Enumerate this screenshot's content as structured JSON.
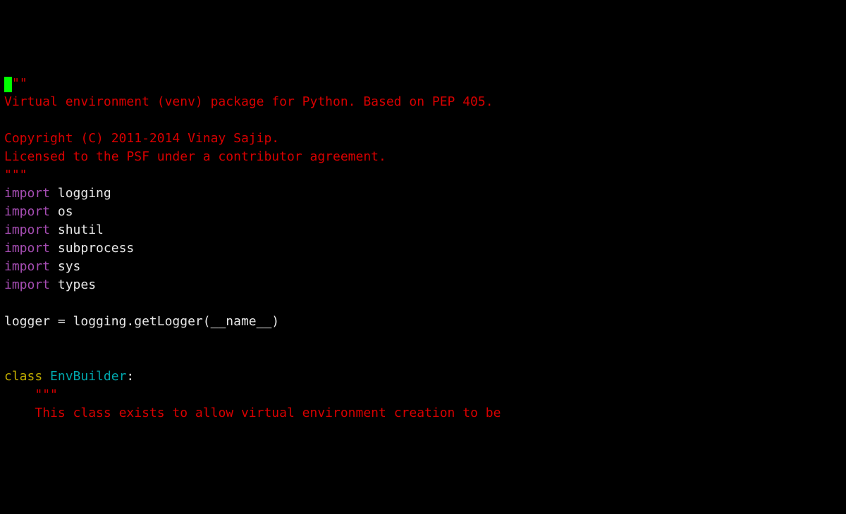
{
  "lines": [
    {
      "type": "docstring_open",
      "text": "\"\"\"",
      "has_cursor": true
    },
    {
      "type": "docstring",
      "text": "Virtual environment (venv) package for Python. Based on PEP 405."
    },
    {
      "type": "blank",
      "text": ""
    },
    {
      "type": "docstring",
      "text": "Copyright (C) 2011-2014 Vinay Sajip."
    },
    {
      "type": "docstring",
      "text": "Licensed to the PSF under a contributor agreement."
    },
    {
      "type": "docstring",
      "text": "\"\"\""
    },
    {
      "type": "import",
      "keyword": "import",
      "module": "logging"
    },
    {
      "type": "import",
      "keyword": "import",
      "module": "os"
    },
    {
      "type": "import",
      "keyword": "import",
      "module": "shutil"
    },
    {
      "type": "import",
      "keyword": "import",
      "module": "subprocess"
    },
    {
      "type": "import",
      "keyword": "import",
      "module": "sys"
    },
    {
      "type": "import",
      "keyword": "import",
      "module": "types"
    },
    {
      "type": "blank",
      "text": ""
    },
    {
      "type": "assign",
      "lhs": "logger ",
      "eq": "=",
      "rhs": " logging.getLogger(__name__)"
    },
    {
      "type": "blank",
      "text": ""
    },
    {
      "type": "blank",
      "text": ""
    },
    {
      "type": "class",
      "keyword": "class",
      "space": " ",
      "name": "EnvBuilder",
      "colon": ":"
    },
    {
      "type": "docstring_indented",
      "indent": "    ",
      "text": "\"\"\""
    },
    {
      "type": "docstring_indented",
      "indent": "    ",
      "text": "This class exists to allow virtual environment creation to be"
    }
  ]
}
